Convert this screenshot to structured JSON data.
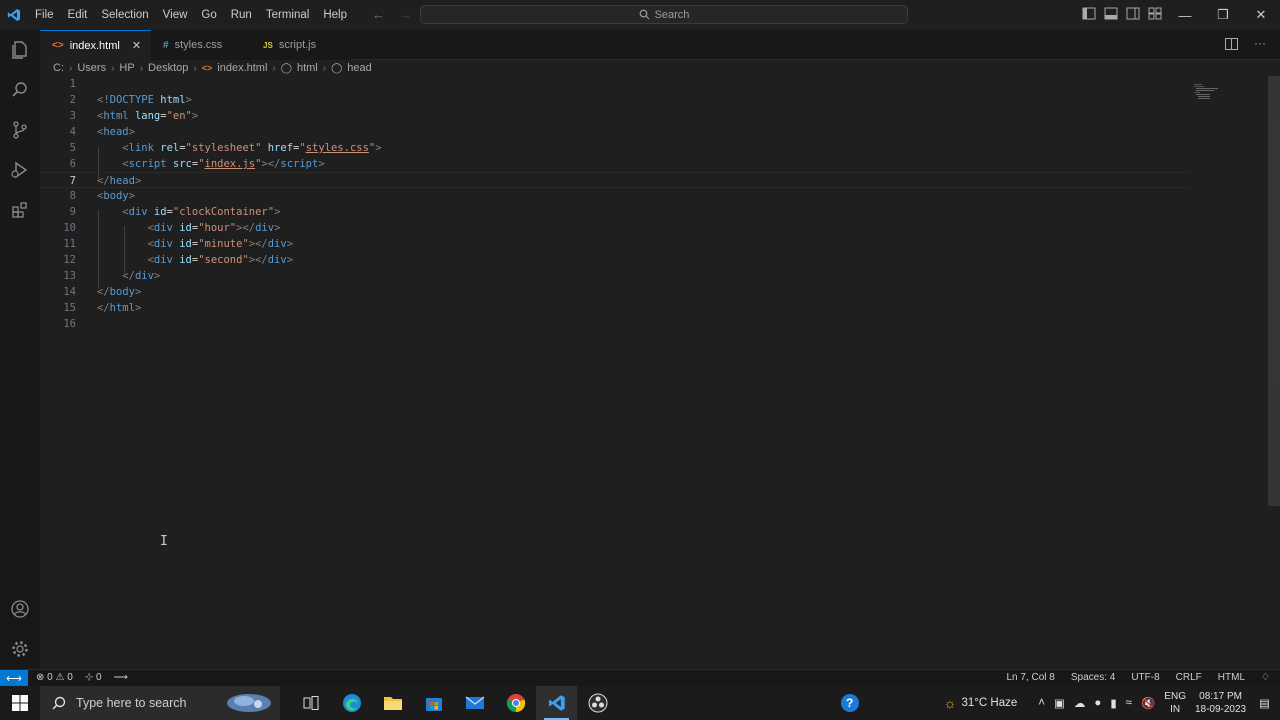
{
  "titlebar": {
    "menu": [
      "File",
      "Edit",
      "Selection",
      "View",
      "Go",
      "Run",
      "Terminal",
      "Help"
    ],
    "search_placeholder": "Search",
    "window_controls": [
      "minimize",
      "restore",
      "close"
    ]
  },
  "tabs": [
    {
      "label": "index.html",
      "icon": "html-icon",
      "active": true
    },
    {
      "label": "styles.css",
      "icon": "css-icon",
      "active": false
    },
    {
      "label": "script.js",
      "icon": "js-icon",
      "active": false
    }
  ],
  "breadcrumb": [
    "C:",
    "Users",
    "HP",
    "Desktop",
    "index.html",
    "html",
    "head"
  ],
  "editor": {
    "line_numbers": [
      "1",
      "2",
      "3",
      "4",
      "5",
      "6",
      "7",
      "8",
      "9",
      "10",
      "11",
      "12",
      "13",
      "14",
      "15",
      "16"
    ],
    "current_line": "7"
  },
  "statusbar": {
    "errors": "0",
    "warnings": "0",
    "ports": "0",
    "position": "Ln 7, Col 8",
    "spaces": "Spaces: 4",
    "encoding": "UTF-8",
    "eol": "CRLF",
    "language": "HTML"
  },
  "taskbar": {
    "search_placeholder": "Type here to search",
    "weather": "31°C  Haze",
    "lang_top": "ENG",
    "lang_bottom": "IN",
    "time": "08:17 PM",
    "date": "18-09-2023"
  },
  "colors": {
    "accent": "#0078d4",
    "editor_bg": "#1f1f1f",
    "tag": "#569cd6",
    "attr": "#9cdcfe",
    "string": "#ce9178"
  }
}
